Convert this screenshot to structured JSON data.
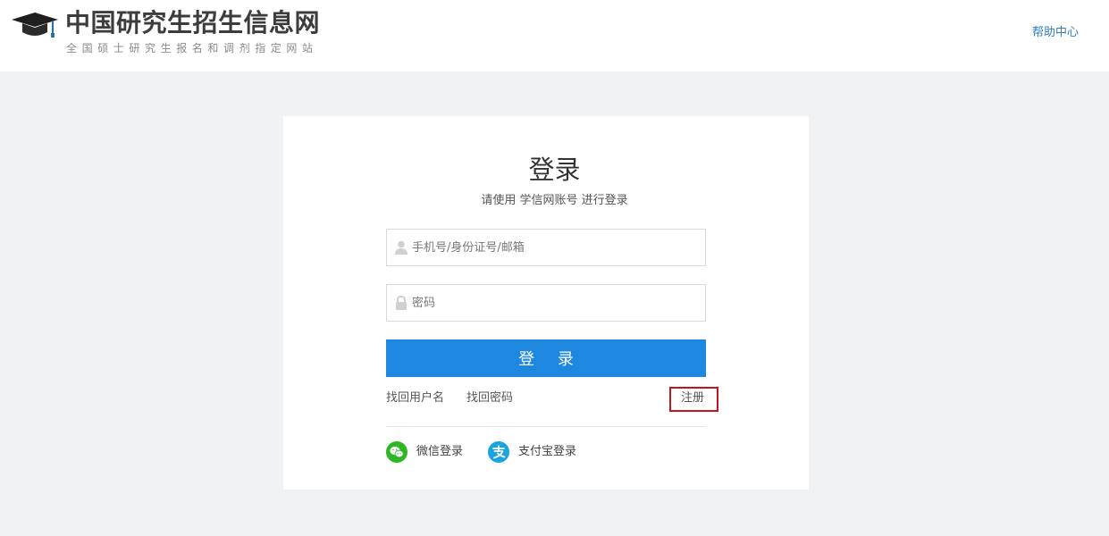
{
  "header": {
    "site_title": "中国研究生招生信息网",
    "site_subtitle": "全国硕士研究生报名和调剂指定网站",
    "help_link": "帮助中心",
    "logo_icon": "graduation-cap-icon"
  },
  "login": {
    "title": "登录",
    "subtitle": "请使用 学信网账号 进行登录",
    "username_placeholder": "手机号/身份证号/邮箱",
    "username_value": "",
    "password_placeholder": "密码",
    "password_value": "",
    "submit_label": "登 录",
    "find_username": "找回用户名",
    "find_password": "找回密码",
    "register": "注册",
    "wechat_login": "微信登录",
    "alipay_login": "支付宝登录"
  },
  "icons": {
    "username": "user-icon",
    "password": "lock-icon",
    "wechat": "wechat-icon",
    "alipay": "alipay-icon"
  },
  "colors": {
    "primary_button": "#1e88e0",
    "help_link": "#2f7dbd",
    "register_highlight": "#c0161c",
    "wechat": "#2eb722",
    "alipay": "#1aa3e0",
    "page_background": "#f1f2f4"
  }
}
